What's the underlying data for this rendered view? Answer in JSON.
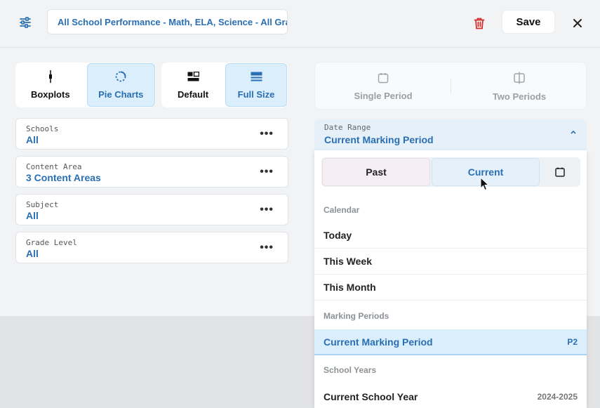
{
  "header": {
    "title": "All School Performance - Math, ELA, Science - All Grades",
    "save_label": "Save"
  },
  "view_groups": [
    {
      "items": [
        {
          "label": "Boxplots",
          "icon": "boxplot-icon",
          "active": false
        },
        {
          "label": "Pie Charts",
          "icon": "pie-chart-icon",
          "active": true
        }
      ]
    },
    {
      "items": [
        {
          "label": "Default",
          "icon": "default-layout-icon",
          "active": false
        },
        {
          "label": "Full Size",
          "icon": "full-size-icon",
          "active": true
        }
      ]
    }
  ],
  "filters": [
    {
      "label": "Schools",
      "value": "All"
    },
    {
      "label": "Content Area",
      "value": "3 Content Areas"
    },
    {
      "label": "Subject",
      "value": "All"
    },
    {
      "label": "Grade Level",
      "value": "All"
    }
  ],
  "period_tabs": {
    "single": "Single Period",
    "two": "Two Periods"
  },
  "date_range": {
    "label": "Date Range",
    "value": "Current Marking Period"
  },
  "dropdown": {
    "seg_past": "Past",
    "seg_current": "Current",
    "sections": {
      "calendar": "Calendar",
      "marking": "Marking Periods",
      "years": "School Years"
    },
    "calendar_items": [
      "Today",
      "This Week",
      "This Month"
    ],
    "marking_item": {
      "label": "Current Marking Period",
      "badge": "P2"
    },
    "year_item": {
      "label": "Current School Year",
      "badge": "2024-2025"
    }
  },
  "colors": {
    "accent": "#2a6fb3",
    "active_bg": "#dbeefb",
    "delete": "#d0312d"
  }
}
